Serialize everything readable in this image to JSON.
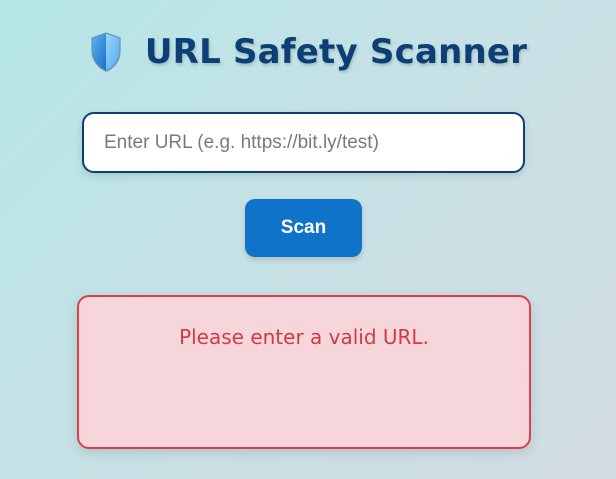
{
  "header": {
    "icon": "shield-icon",
    "title": "URL Safety Scanner"
  },
  "url_input": {
    "value": "",
    "placeholder": "Enter URL (e.g. https://bit.ly/test)"
  },
  "scan_button": {
    "label": "Scan"
  },
  "result": {
    "message": "Please enter a valid URL.",
    "status": "error"
  },
  "colors": {
    "title": "#0d3f76",
    "button": "#0f73c9",
    "error_text": "#d23a47",
    "error_border": "#d9414f",
    "error_background": "#f6d6db"
  }
}
